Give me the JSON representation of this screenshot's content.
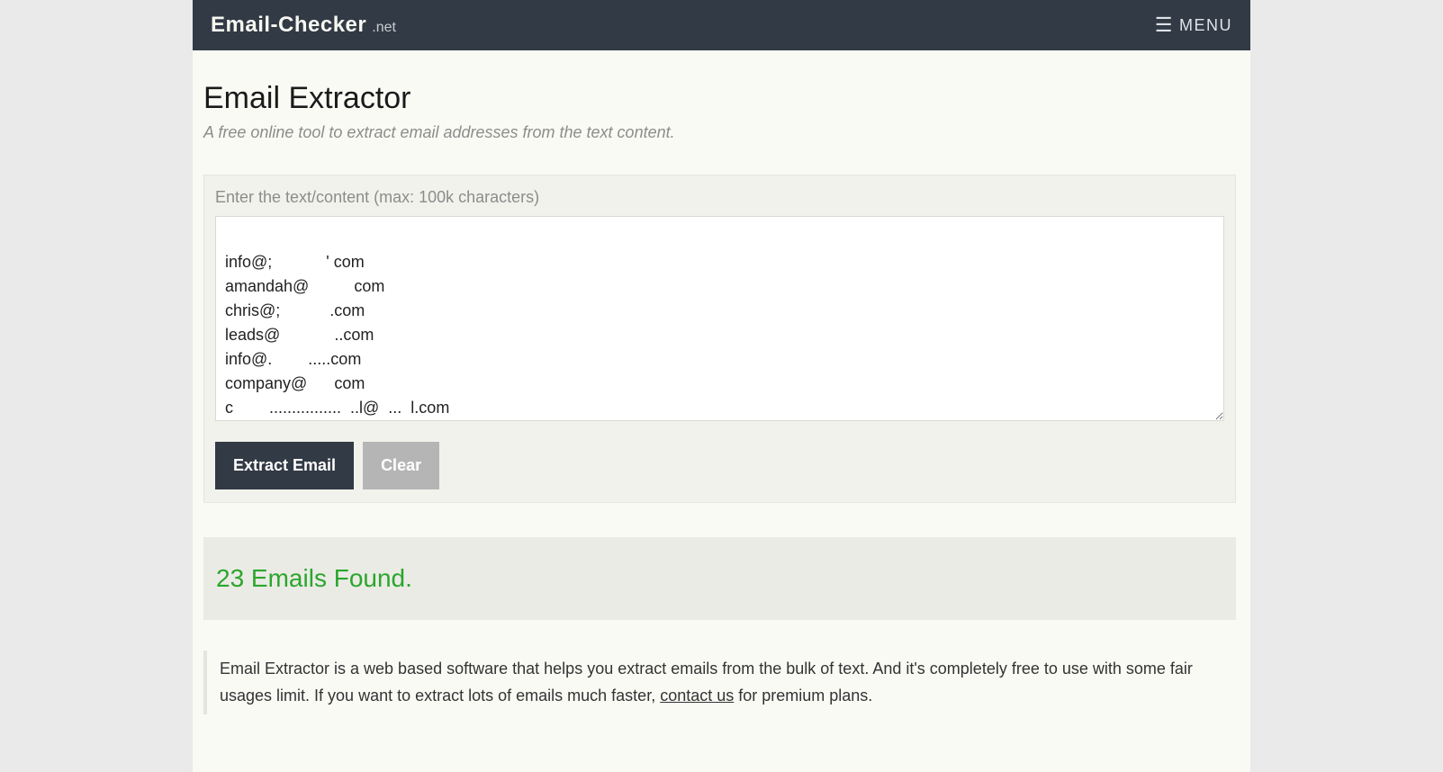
{
  "header": {
    "brand_main": "Email-Checker",
    "brand_tld": ".net",
    "menu_label": "MENU"
  },
  "page": {
    "title": "Email Extractor",
    "subtitle": "A free online tool to extract email addresses from the text content."
  },
  "form": {
    "label": "Enter the text/content (max: 100k characters)",
    "content": "\ninfo@;            ' com\namandah@          com\nchris@;           .com\nleads@            ..com\ninfo@.        .....com\ncompany@      com\nc        ................  ..l@  ...  l.com\nha horra@amail com",
    "extract_label": "Extract Email",
    "clear_label": "Clear"
  },
  "results": {
    "status": "23 Emails Found."
  },
  "info": {
    "text_before_link": "Email Extractor is a web based software that helps you extract emails from the bulk of text. And it's completely free to use with some fair usages limit. If you want to extract lots of emails much faster, ",
    "link_text": "contact us",
    "text_after_link": " for premium plans."
  }
}
